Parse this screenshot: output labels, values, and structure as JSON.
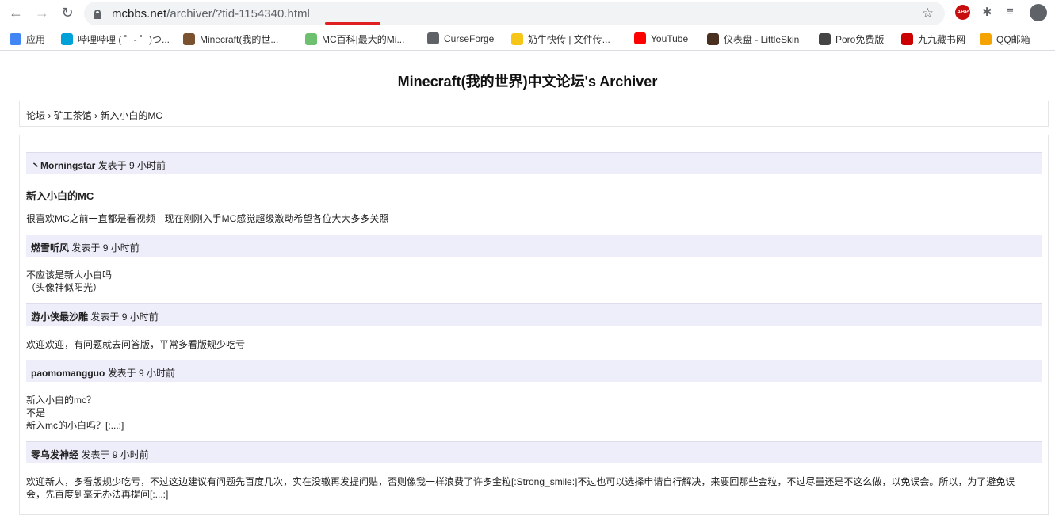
{
  "browser": {
    "url_host": "mcbbs.net",
    "url_path": "/archiver/?tid-1154340.html",
    "bookmarks": [
      {
        "label": "应用",
        "icon": "apps-grid-icon",
        "color": "#4285f4"
      },
      {
        "label": "哔哩哔哩 ( ゜- ゜)つ...",
        "icon": "bilibili-icon",
        "color": "#00a1d6"
      },
      {
        "label": "Minecraft(我的世...",
        "icon": "minecraft-icon",
        "color": "#7a5230"
      },
      {
        "label": "MC百科|最大的Mi...",
        "icon": "mcmod-icon",
        "color": "#6cc070"
      },
      {
        "label": "CurseForge",
        "icon": "globe-icon",
        "color": "#5f6368"
      },
      {
        "label": "奶牛快传 | 文件传...",
        "icon": "cow-icon",
        "color": "#f5c518"
      },
      {
        "label": "YouTube",
        "icon": "youtube-icon",
        "color": "#ff0000"
      },
      {
        "label": "仪表盘 - LittleSkin",
        "icon": "littleskin-icon",
        "color": "#4a3020"
      },
      {
        "label": "Poro免费版",
        "icon": "poro-icon",
        "color": "#444444"
      },
      {
        "label": "九九藏书网",
        "icon": "book-icon",
        "color": "#cc0000"
      },
      {
        "label": "QQ邮箱",
        "icon": "qqmail-icon",
        "color": "#f4a300"
      }
    ]
  },
  "page": {
    "title": "Minecraft(我的世界)中文论坛's Archiver",
    "breadcrumb": [
      "论坛",
      "矿工茶馆",
      "新入小白的MC"
    ],
    "thread_title": "新入小白的MC",
    "posts": [
      {
        "author": "丶Morningstar",
        "meta": "发表于 9 小时前",
        "lines": [
          "很喜欢MC之前一直都是看视频　现在刚刚入手MC感觉超级激动希望各位大大多多关照"
        ]
      },
      {
        "author": "燃雪听风",
        "meta": "发表于 9 小时前",
        "lines": [
          "不应该是新人小白吗",
          "（头像神似阳光）"
        ]
      },
      {
        "author": "游小侠最沙雕",
        "meta": "发表于 9 小时前",
        "lines": [
          "欢迎欢迎，有问题就去问答版，平常多看版规少吃亏"
        ]
      },
      {
        "author": "paomomangguo",
        "meta": "发表于 9 小时前",
        "lines": [
          "新入小白的mc？",
          "不是",
          "新入mc的小白吗？[:...:]"
        ]
      },
      {
        "author": "零乌发神经",
        "meta": "发表于 9 小时前",
        "lines": [
          "欢迎新人，多看版规少吃亏，不过这边建议有问题先百度几次，实在没辙再发提问贴，否则像我一样浪费了许多金粒[:Strong_smile:]不过也可以选择申请自行解决，来要回那些金粒，不过尽量还是不这么做，以免误会。所以，为了避免误会，先百度到毫无办法再提问[:...:]"
        ]
      }
    ]
  }
}
